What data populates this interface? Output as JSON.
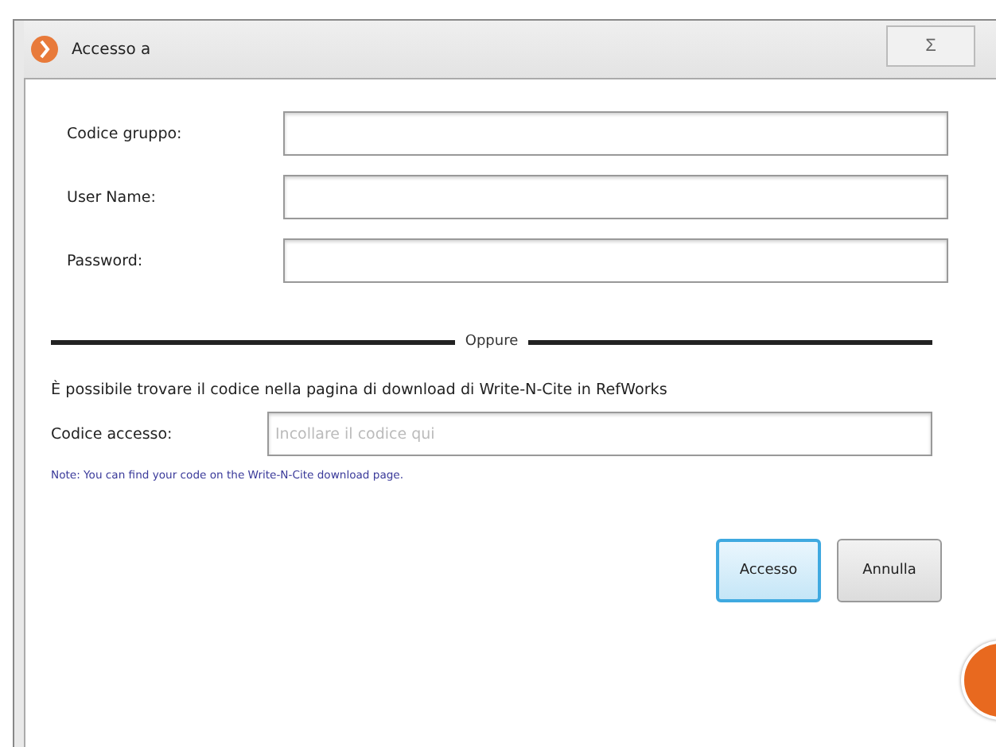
{
  "window": {
    "title": "Accesso a",
    "close": "Σ"
  },
  "fields": [
    {
      "label": "Codice gruppo:"
    },
    {
      "label": "User Name:"
    },
    {
      "label": "Password:"
    }
  ],
  "separator": "Oppure",
  "hint": "È possibile trovare il codice nella pagina di download di Write-N-Cite in RefWorks",
  "access_code": {
    "label": "Codice accesso:",
    "placeholder": "Incollare il codice qui"
  },
  "note": "Note: You can find your code on the Write-N-Cite download page.",
  "buttons": [
    {
      "label": "Accesso",
      "selected": true
    },
    {
      "label": "Annulla",
      "selected": false
    }
  ]
}
